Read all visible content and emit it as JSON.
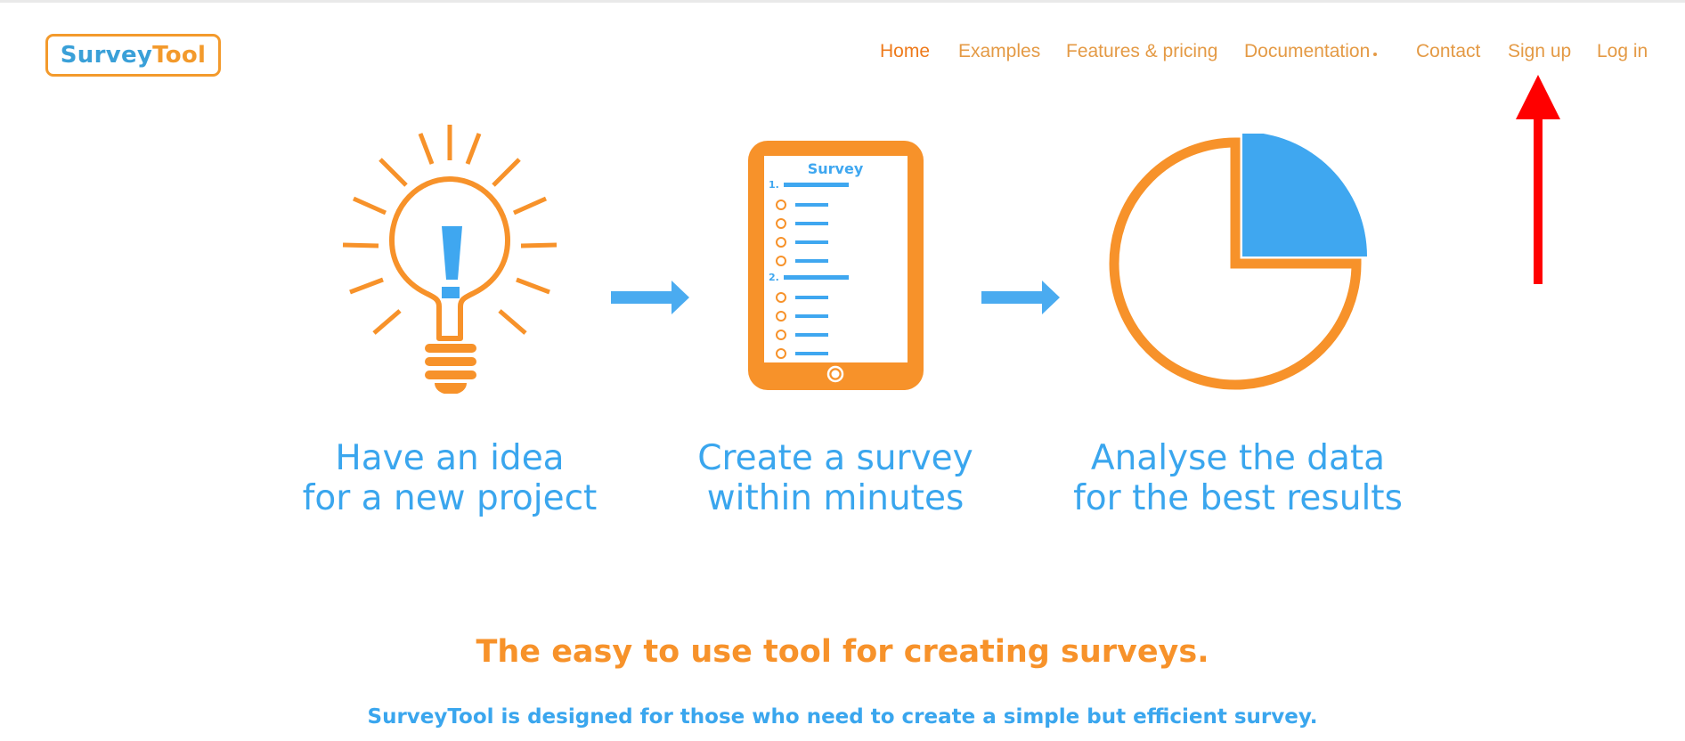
{
  "brand": {
    "part1": "Survey",
    "part2": "Tool",
    "primary": "#3aa0d8",
    "accent": "#f39a2c"
  },
  "nav": {
    "items": [
      {
        "label": "Home",
        "active": true
      },
      {
        "label": "Examples"
      },
      {
        "label": "Features & pricing"
      },
      {
        "label": "Documentation",
        "has_dropdown": true
      },
      {
        "label": "Contact"
      },
      {
        "label": "Sign up"
      },
      {
        "label": "Log in"
      }
    ]
  },
  "annotation": {
    "type": "red-arrow",
    "points_to": "Sign up",
    "color": "#ff0000"
  },
  "hero": {
    "tablet": {
      "title": "Survey",
      "questions": [
        {
          "number": "1.",
          "options": 4
        },
        {
          "number": "2.",
          "options": 4
        }
      ]
    },
    "pie": {
      "highlighted_fraction": 0.25
    },
    "steps": [
      {
        "line1": "Have an idea",
        "line2": "for a new project",
        "icon": "lightbulb-icon"
      },
      {
        "line1": "Create a survey",
        "line2": "within minutes",
        "icon": "tablet-survey-icon"
      },
      {
        "line1": "Analyse the data",
        "line2": "for the best results",
        "icon": "pie-chart-icon"
      }
    ]
  },
  "tagline": "The easy to use tool for creating surveys.",
  "subline": "SurveyTool is designed for those who need to create a simple but efficient survey.",
  "colors": {
    "orange": "#f7922a",
    "blue": "#3aa6ee",
    "nav": "#e49a45",
    "nav_active": "#ee7a1b"
  }
}
